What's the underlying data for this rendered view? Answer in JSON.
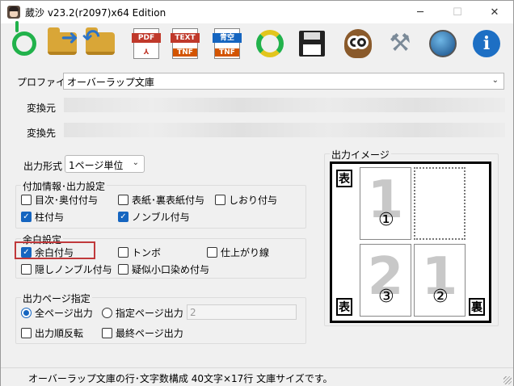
{
  "window": {
    "title": "葳沙 v23.2(r2097)x64 Edition"
  },
  "toolbar": {
    "pdf_label": "PDF",
    "text_label": "TEXT",
    "tnf_label": "TNF",
    "aozora_label": "青空",
    "icons": [
      "power-icon",
      "open-folder-icon",
      "folder-back-icon",
      "pdf-icon",
      "text-tnf-icon",
      "aozora-tnf-icon",
      "refresh-icon",
      "save-icon",
      "owl-icon",
      "tools-icon",
      "globe-icon",
      "info-icon"
    ]
  },
  "profile": {
    "label": "プロファイル",
    "value": "オーバーラップ文庫"
  },
  "source": {
    "label": "変換元"
  },
  "dest": {
    "label": "変換先"
  },
  "output_format": {
    "label": "出力形式",
    "value": "1ページ単位"
  },
  "extra_info": {
    "title": "付加情報･出力設定",
    "toc": {
      "label": "目次･奥付付与",
      "checked": false
    },
    "cover": {
      "label": "表紙･裏表紙付与",
      "checked": false
    },
    "bookmark": {
      "label": "しおり付与",
      "checked": false
    },
    "hashira": {
      "label": "柱付与",
      "checked": true
    },
    "nombre": {
      "label": "ノンブル付与",
      "checked": true
    }
  },
  "margin": {
    "title": "余白設定",
    "margin_add": {
      "label": "余白付与",
      "checked": true
    },
    "tombo": {
      "label": "トンボ",
      "checked": false
    },
    "trim_line": {
      "label": "仕上がり線",
      "checked": false
    },
    "hidden_nombre": {
      "label": "隠しノンブル付与",
      "checked": false
    },
    "koguchi": {
      "label": "疑似小口染め付与",
      "checked": false
    }
  },
  "output_pages": {
    "title": "出力ページ指定",
    "all_pages": {
      "label": "全ページ出力",
      "selected": true
    },
    "specified": {
      "label": "指定ページ出力",
      "selected": false
    },
    "page_value": "2",
    "reverse": {
      "label": "出力順反転",
      "checked": false
    },
    "last_page": {
      "label": "最終ページ出力",
      "checked": false
    }
  },
  "preview": {
    "title": "出力イメージ",
    "front_tag": "表",
    "front_tag_bottom": "表",
    "back_tag": "裏",
    "page1_num": "1",
    "page2_num": "2",
    "page3_num": "1",
    "circle1": "①",
    "circle3": "③",
    "circle2": "②"
  },
  "status": {
    "text": "オーバーラップ文庫の行･文字数構成 40文字×17行 文庫サイズです。"
  },
  "colors": {
    "accent": "#1565c0",
    "highlight": "#c0393b"
  }
}
